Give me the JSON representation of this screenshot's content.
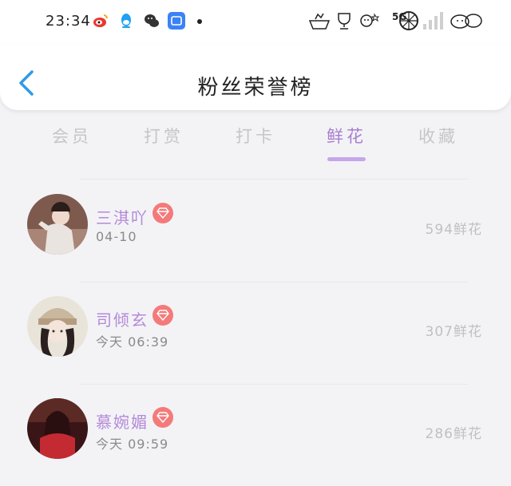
{
  "status_bar": {
    "time": "23:34",
    "network": "5G",
    "app_icons": [
      "weibo-icon",
      "qq-icon",
      "wechat-icon",
      "app-icon"
    ],
    "right_icons": [
      "decor-icon",
      "trophy-icon",
      "decor-icon",
      "lemon-icon",
      "signal-icon",
      "decor-icon"
    ]
  },
  "header": {
    "title": "粉丝荣誉榜"
  },
  "tabs": [
    {
      "label": "会员"
    },
    {
      "label": "打赏"
    },
    {
      "label": "打卡"
    },
    {
      "label": "鲜花",
      "active": true
    },
    {
      "label": "收藏"
    }
  ],
  "fans": [
    {
      "name": "三淇吖",
      "date": "04-10",
      "amount": "594鲜花"
    },
    {
      "name": "司倾玄",
      "date": "今天 06:39",
      "amount": "307鲜花"
    },
    {
      "name": "慕婉媚",
      "date": "今天 09:59",
      "amount": "286鲜花"
    }
  ],
  "colors": {
    "accent": "#a87fd0",
    "name": "#b48ad8",
    "badge": "#f47a7a",
    "tab_inactive": "#c6c6c6",
    "back": "#2f9be6"
  }
}
